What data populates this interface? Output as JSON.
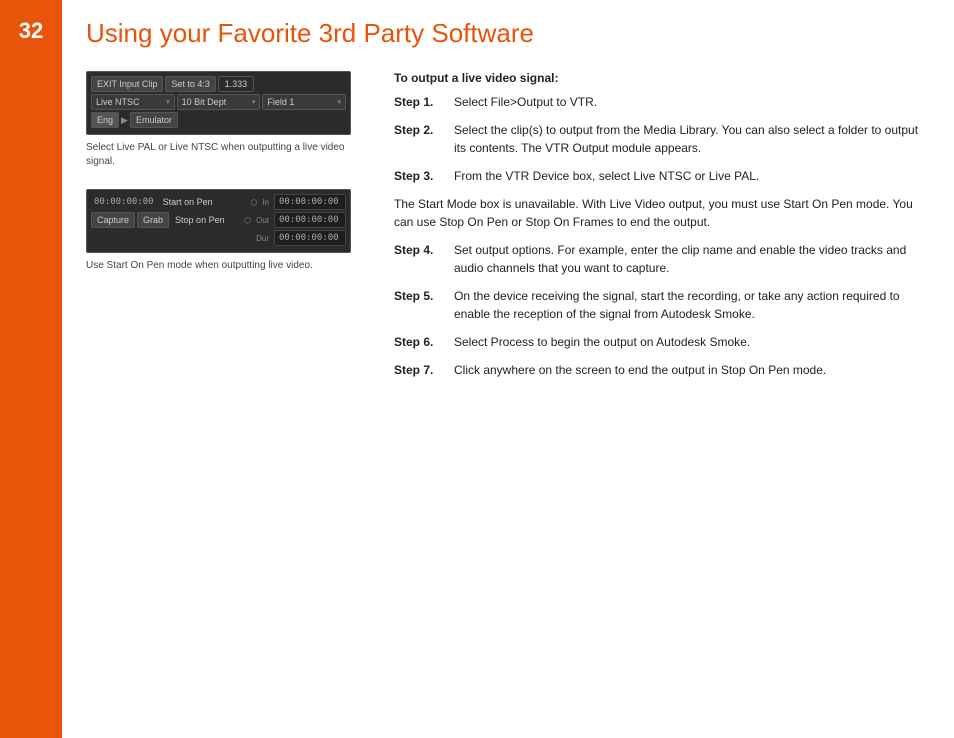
{
  "sidebar": {
    "page_number": "32"
  },
  "page": {
    "title": "Using your Favorite 3rd Party Software"
  },
  "screenshot1": {
    "row1": {
      "btn1": "EXIT Input Clip",
      "btn2": "Set to 4:3",
      "value": "1.333"
    },
    "row2": {
      "select1": "Live NTSC",
      "select2": "10 Bit Dept",
      "select3": "Field 1"
    },
    "row3": {
      "btn1": "Eng",
      "btn2": "Emulator"
    },
    "caption": "Select Live PAL or Live NTSC when outputting a live video signal."
  },
  "screenshot2": {
    "row1": {
      "timecode": "00:00:00:00",
      "label": "Start on Pen",
      "arrow": "⬡",
      "in_label": "In",
      "tc_value": "00:00:00:00"
    },
    "row2": {
      "btn1": "Capture",
      "btn2": "Grab",
      "label": "Stop on Pen",
      "arrow": "⬡",
      "out_label": "Out",
      "tc_value": "00:00:00:00"
    },
    "row3": {
      "dur_label": "Dur",
      "tc_value": "00:00:00:00"
    },
    "caption": "Use Start On Pen mode when outputting live video."
  },
  "steps": {
    "section_title": "To output a live video signal:",
    "items": [
      {
        "label": "Step 1.",
        "text": "Select File>Output to VTR."
      },
      {
        "label": "Step 2.",
        "text": "Select the clip(s) to output from the Media Library. You can also select a folder to output its contents. The VTR Output module appears."
      },
      {
        "label": "Step 3.",
        "text": "From the VTR Device box, select Live NTSC or Live PAL."
      },
      {
        "label": "note",
        "text": "The Start Mode box is unavailable. With Live Video output, you must use Start On Pen mode. You can use Stop On Pen or Stop On Frames to end the output."
      },
      {
        "label": "Step 4.",
        "text": "Set output options. For example, enter the clip name and enable the video tracks and audio channels that you want to capture."
      },
      {
        "label": "Step 5.",
        "text": "On the device receiving the signal, start the recording, or take any action required to enable the reception of the signal from Autodesk Smoke."
      },
      {
        "label": "Step 6.",
        "text": "Select Process to begin the output on Autodesk Smoke."
      },
      {
        "label": "Step 7.",
        "text": "Click anywhere on the screen to end the output in Stop On Pen mode."
      }
    ]
  }
}
